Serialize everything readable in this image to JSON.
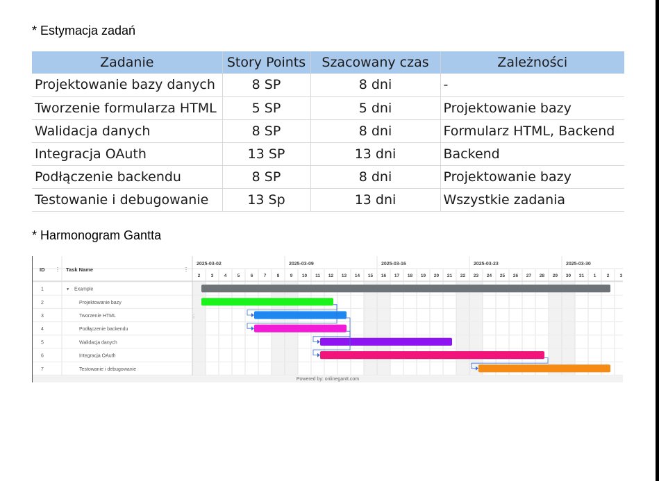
{
  "section_estimation": {
    "heading": "* Estymacja zadań",
    "columns": [
      "Zadanie",
      "Story Points",
      "Szacowany czas",
      "Zależności"
    ],
    "rows": [
      [
        "Projektowanie bazy danych",
        "8 SP",
        "8 dni",
        "-"
      ],
      [
        "Tworzenie formularza HTML",
        "5 SP",
        "5 dni",
        "Projektowanie bazy"
      ],
      [
        "Walidacja danych",
        "8 SP",
        "8 dni",
        "Formularz HTML, Backend"
      ],
      [
        "Integracja OAuth",
        "13 SP",
        "13 dni",
        "Backend"
      ],
      [
        "Podłączenie backendu",
        "8 SP",
        "8 dni",
        "Projektowanie bazy"
      ],
      [
        "Testowanie i debugowanie",
        "13 Sp",
        "13 dni",
        "Wszystkie zadania"
      ]
    ],
    "header_color": "#a8c8ec"
  },
  "section_gantt": {
    "heading": "* Harmonogram Gantta",
    "col_id": "ID",
    "col_task": "Task Name",
    "week_labels": [
      "2025-03-02",
      "2025-03-09",
      "2025-03-16",
      "2025-03-23",
      "2025-03-30"
    ],
    "days": [
      "2",
      "3",
      "4",
      "5",
      "6",
      "7",
      "8",
      "9",
      "10",
      "11",
      "12",
      "13",
      "14",
      "15",
      "16",
      "17",
      "18",
      "19",
      "20",
      "21",
      "22",
      "23",
      "24",
      "25",
      "26",
      "27",
      "28",
      "29",
      "30",
      "31",
      "1",
      "2",
      "3"
    ],
    "tasks": [
      {
        "id": "1",
        "name": "Example",
        "group": true,
        "start": 0,
        "dur": 31,
        "color": "#6e7378"
      },
      {
        "id": "2",
        "name": "Projektowanie bazy",
        "start": 0,
        "dur": 10,
        "color": "#1cf21c"
      },
      {
        "id": "3",
        "name": "Tworzenie HTML",
        "start": 4,
        "dur": 7,
        "color": "#1e88f0",
        "dep": 2
      },
      {
        "id": "4",
        "name": "Podłączenie backendu",
        "start": 4,
        "dur": 7,
        "color": "#f21cd8",
        "dep": 2
      },
      {
        "id": "5",
        "name": "Walidacja danych",
        "start": 9,
        "dur": 10,
        "color": "#8e14f2",
        "dep": 3
      },
      {
        "id": "6",
        "name": "Integracja OAuth",
        "start": 9,
        "dur": 17,
        "color": "#f2147a",
        "dep": 4
      },
      {
        "id": "7",
        "name": "Testowanie i debugowanie",
        "start": 21,
        "dur": 10,
        "color": "#f58a14",
        "dep": 6
      }
    ],
    "footer": "Powered by: onlinegantt.com"
  }
}
